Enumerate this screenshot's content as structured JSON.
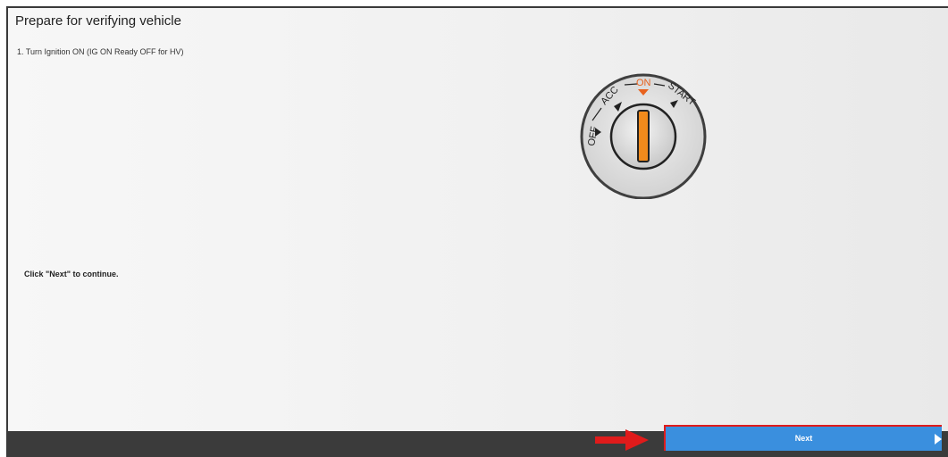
{
  "window": {
    "title": "Prepare for verifying vehicle"
  },
  "content": {
    "step_text": "1. Turn Ignition ON (IG ON Ready OFF for HV)",
    "instruction": "Click \"Next\" to continue."
  },
  "ignition": {
    "icon": "ignition-key-switch-icon",
    "positions": [
      "OFF",
      "ACC",
      "ON",
      "START"
    ],
    "selected_position": "ON",
    "accent_color": "#e8621e",
    "key_color": "#f08a1c"
  },
  "footer": {
    "next_label": "Next",
    "next_color": "#3a8fde",
    "highlight_color": "#e01b1b"
  }
}
